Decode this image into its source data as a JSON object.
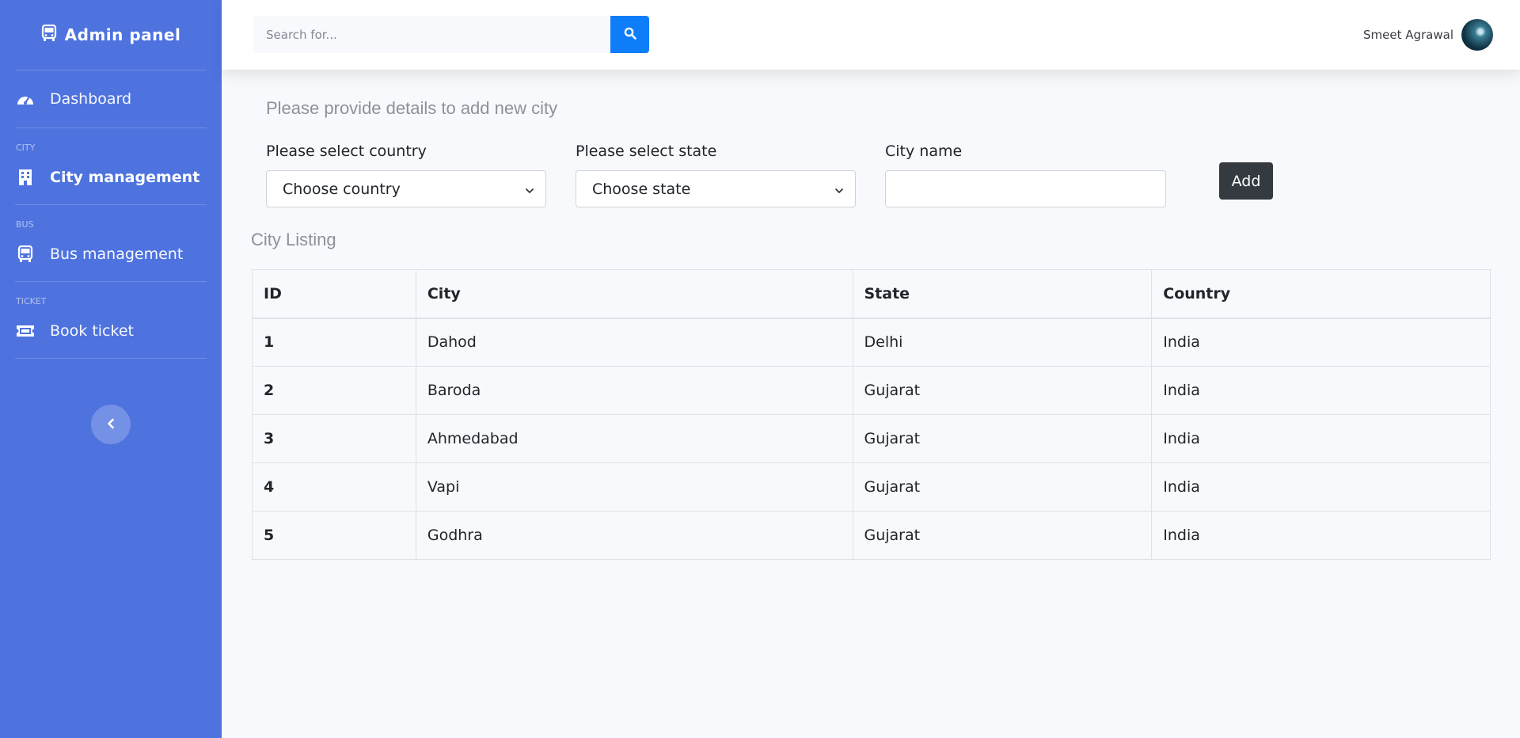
{
  "sidebar": {
    "brand": "Admin panel",
    "items": [
      {
        "label": "Dashboard"
      },
      {
        "heading": "CITY",
        "label": "City management"
      },
      {
        "heading": "BUS",
        "label": "Bus management"
      },
      {
        "heading": "TICKET",
        "label": "Book ticket"
      }
    ]
  },
  "topbar": {
    "search_placeholder": "Search for...",
    "user_name": "Smeet Agrawal"
  },
  "form": {
    "title": "Please provide details to add new city",
    "country_label": "Please select country",
    "country_value": "Choose country",
    "state_label": "Please select state",
    "state_value": "Choose state",
    "city_label": "City name",
    "city_value": "",
    "add_label": "Add"
  },
  "listing": {
    "title": "City Listing",
    "columns": [
      "ID",
      "City",
      "State",
      "Country"
    ],
    "rows": [
      [
        "1",
        "Dahod",
        "Delhi",
        "India"
      ],
      [
        "2",
        "Baroda",
        "Gujarat",
        "India"
      ],
      [
        "3",
        "Ahmedabad",
        "Gujarat",
        "India"
      ],
      [
        "4",
        "Vapi",
        "Gujarat",
        "India"
      ],
      [
        "5",
        "Godhra",
        "Gujarat",
        "India"
      ]
    ]
  },
  "colors": {
    "sidebar": "#4e73df",
    "search_button": "#0d7ef7",
    "add_button": "#343a40"
  }
}
